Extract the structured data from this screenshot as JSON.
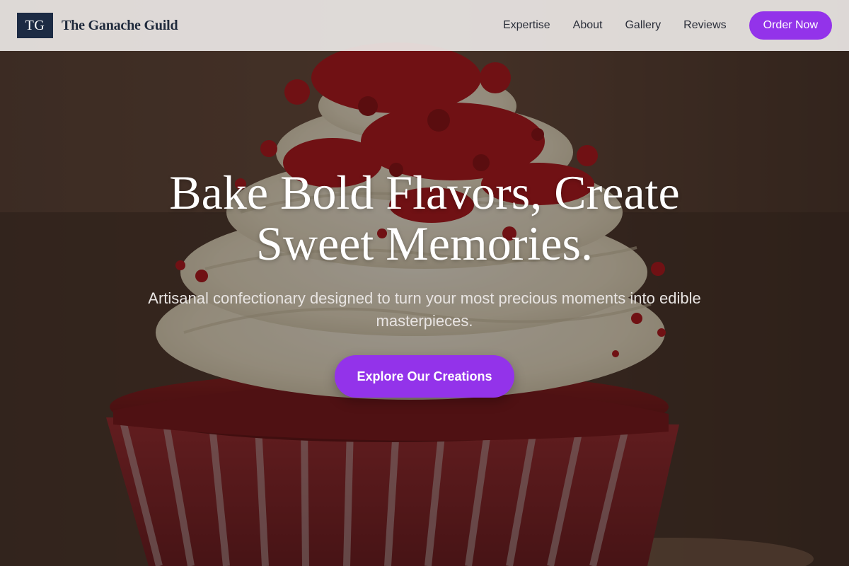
{
  "brand": {
    "initials": "TG",
    "name": "The Ganache Guild"
  },
  "nav": {
    "links": [
      {
        "label": "Expertise"
      },
      {
        "label": "About"
      },
      {
        "label": "Gallery"
      },
      {
        "label": "Reviews"
      }
    ],
    "cta_label": "Order Now"
  },
  "hero": {
    "title": "Bake Bold Flavors, Create Sweet Memories.",
    "subtitle": "Artisanal confectionary designed to turn your most precious moments into edible masterpieces.",
    "cta_label": "Explore Our Creations",
    "image_subject": "red velvet cupcake with cream cheese frosting"
  },
  "colors": {
    "accent": "#9333ea",
    "brand_mark_bg": "#1c2b44",
    "nav_bg": "#ece8e6"
  }
}
